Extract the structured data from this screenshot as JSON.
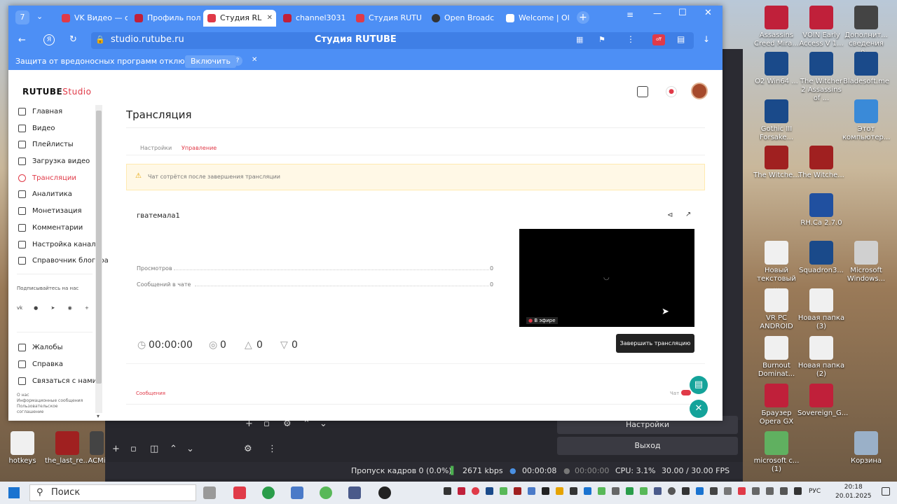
{
  "browser": {
    "tabs": [
      {
        "label": "VK Видео — с",
        "color": "#e03a48"
      },
      {
        "label": "Профиль пол",
        "color": "#c0203a"
      },
      {
        "label": "Студия RL",
        "color": "#e03a48"
      },
      {
        "label": "channel3031",
        "color": "#c0203a"
      },
      {
        "label": "Студия RUTU",
        "color": "#e03a48"
      },
      {
        "label": "Open Broadc",
        "color": "#333333"
      },
      {
        "label": "Welcome | OI",
        "color": "#ffffff"
      }
    ],
    "url": "studio.rutube.ru",
    "page_title": "Студия RUTUBE",
    "protection_text": "Защита от вредоносных программ отключена",
    "enable_label": "Включить",
    "help_label": "?"
  },
  "studio": {
    "logo_main": "RUTUBE",
    "logo_sub": "Studio",
    "sidebar": [
      {
        "label": "Главная"
      },
      {
        "label": "Видео"
      },
      {
        "label": "Плейлисты"
      },
      {
        "label": "Загрузка видео"
      },
      {
        "label": "Трансляции"
      },
      {
        "label": "Аналитика"
      },
      {
        "label": "Монетизация"
      },
      {
        "label": "Комментарии"
      },
      {
        "label": "Настройка канала"
      },
      {
        "label": "Справочник блогера"
      }
    ],
    "subscribe_label": "Подписывайтесь на нас",
    "social": [
      "vk",
      "ok",
      "tg",
      "yt",
      "+"
    ],
    "bottom_items": [
      {
        "label": "Жалобы"
      },
      {
        "label": "Справка"
      },
      {
        "label": "Связаться с нами"
      }
    ],
    "footer_links": [
      "О нас",
      "Информационные сообщения",
      "Пользовательское",
      "соглашение"
    ],
    "heading": "Трансляция",
    "tab_settings": "Настройки",
    "tab_manage": "Управление",
    "warning": "Чат сотрётся после завершения трансляции",
    "stream_title": "гватемала1",
    "stat_views_label": "Просмотров",
    "stat_views_value": "0",
    "stat_chat_label": "Сообщений в чате",
    "stat_chat_value": "0",
    "live_label": "В эфире",
    "end_label": "Завершить трансляцию",
    "timer": "00:00:00",
    "viewers": "0",
    "likes": "0",
    "dislikes": "0",
    "messages_label": "Сообщения",
    "chat_toggle_label": "Чат"
  },
  "obs": {
    "settings_label": "Настройки",
    "exit_label": "Выход",
    "dropped": "Пропуск кадров 0 (0.0%)",
    "bitrate": "2671 kbps",
    "rec_time": "00:00:08",
    "stream_time": "00:00:00",
    "cpu": "CPU: 3.1%",
    "fps": "30.00 / 30.00 FPS"
  },
  "desktop_icons": [
    {
      "label": "Assassins Creed Mira...",
      "color": "#c0203a"
    },
    {
      "label": "VOIN Early Access V 1...",
      "color": "#c0203a"
    },
    {
      "label": "Дополнит... сведения о...",
      "color": "#444444"
    },
    {
      "label": "O2 Win64 ...",
      "color": "#1a4a8a"
    },
    {
      "label": "The Witcher 2 Assassins of ...",
      "color": "#1a4a8a"
    },
    {
      "label": "Bladesoft.me",
      "color": "#1a4a8a"
    },
    {
      "label": "Gothic III Forsake...",
      "color": "#1a4a8a"
    },
    {
      "label": "Этот компьютер...",
      "color": "#3a8ad8"
    },
    {
      "label": "The Witche...",
      "color": "#a02020"
    },
    {
      "label": "The Witche...",
      "color": "#a02020"
    },
    {
      "label": "RH.Ca 2.7.0",
      "color": "#2050a0"
    },
    {
      "label": "Новый текстовый ...",
      "color": "#f0f0f0"
    },
    {
      "label": "Squadron3...",
      "color": "#1a4a8a"
    },
    {
      "label": "Microsoft Windows...",
      "color": "#d0d0d0"
    },
    {
      "label": "VR PC ANDROID",
      "color": "#f0f0f0"
    },
    {
      "label": "Новая папка (3)",
      "color": "#f0f0f0"
    },
    {
      "label": "Burnout Dominat...",
      "color": "#f0f0f0"
    },
    {
      "label": "Новая папка (2)",
      "color": "#f0f0f0"
    },
    {
      "label": "Браузер Opera GX",
      "color": "#c0203a"
    },
    {
      "label": "Sovereign_G...",
      "color": "#c0203a"
    },
    {
      "label": "microsoft c... (1)",
      "color": "#60b060"
    },
    {
      "label": "Корзина",
      "color": "#9ab0c8"
    },
    {
      "label": "hotkeys",
      "color": "#f0f0f0"
    },
    {
      "label": "the_last_re...",
      "color": "#a02020"
    },
    {
      "label": "ACMi",
      "color": "#444444"
    }
  ],
  "taskbar": {
    "search_placeholder": "Поиск",
    "lang": "РУС",
    "time": "20:18",
    "date": "20.01.2025"
  }
}
